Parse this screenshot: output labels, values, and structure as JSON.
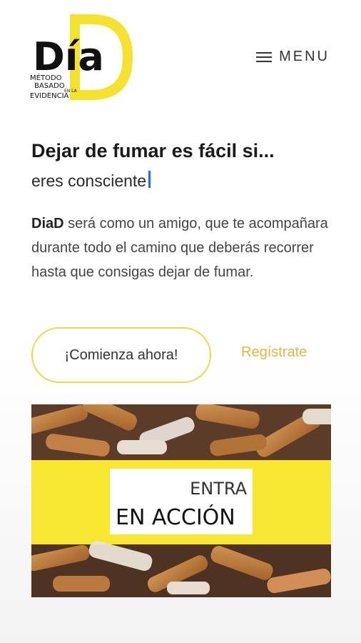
{
  "brand": {
    "logo_word": "DíaD",
    "logo_tagline": [
      "MÉTODO",
      "BASADO",
      "EN LA",
      "EVIDENCIA"
    ],
    "accent_color": "#f5e22e",
    "button_border_color": "#f2d64a",
    "link_color": "#e3b83a"
  },
  "nav": {
    "menu_label": "MENU",
    "menu_icon": "hamburger-icon"
  },
  "hero": {
    "headline": "Dejar de fumar es fácil si...",
    "subline": "eres consciente"
  },
  "intro": {
    "brand_bold": "DiaD",
    "text": " será como un amigo, que te acompañara durante todo el camino que deberás recorrer hasta que consigas dejar de fumar."
  },
  "actions": {
    "start_label": "¡Comienza ahora!",
    "register_label": "Regístrate"
  },
  "banner": {
    "line1": "ENTRA",
    "line2": "EN ACCIÓN"
  }
}
